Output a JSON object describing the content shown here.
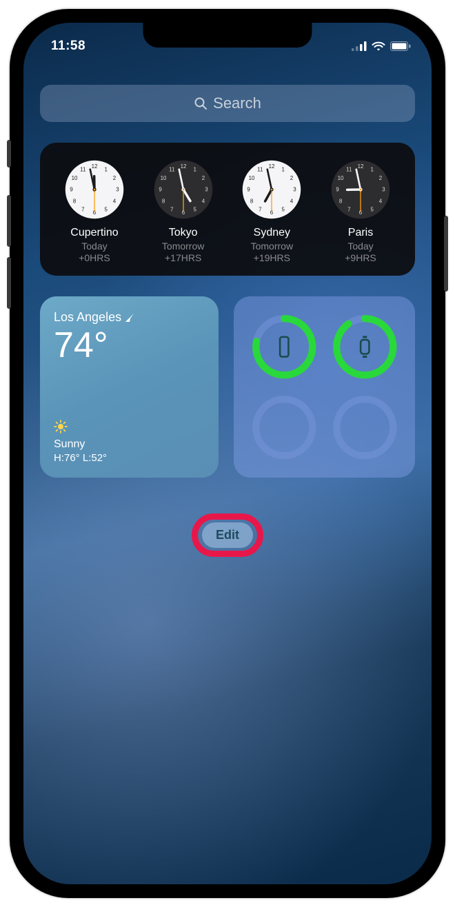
{
  "status": {
    "time": "11:58"
  },
  "search": {
    "placeholder": "Search"
  },
  "world_clock": {
    "clocks": [
      {
        "city": "Cupertino",
        "day": "Today",
        "offset": "+0HRS",
        "hour": 11,
        "min": 58,
        "dark": false
      },
      {
        "city": "Tokyo",
        "day": "Tomorrow",
        "offset": "+17HRS",
        "hour": 4,
        "min": 58,
        "dark": true
      },
      {
        "city": "Sydney",
        "day": "Tomorrow",
        "offset": "+19HRS",
        "hour": 6,
        "min": 58,
        "dark": false
      },
      {
        "city": "Paris",
        "day": "Today",
        "offset": "+9HRS",
        "hour": 8,
        "min": 58,
        "dark": true
      }
    ]
  },
  "weather": {
    "city": "Los Angeles",
    "temp": "74°",
    "condition": "Sunny",
    "high_low": "H:76° L:52°"
  },
  "batteries": {
    "rings": [
      {
        "device": "phone",
        "pct": 78
      },
      {
        "device": "watch",
        "pct": 90
      },
      {
        "device": "empty",
        "pct": 0
      },
      {
        "device": "empty",
        "pct": 0
      }
    ]
  },
  "edit": {
    "label": "Edit"
  }
}
